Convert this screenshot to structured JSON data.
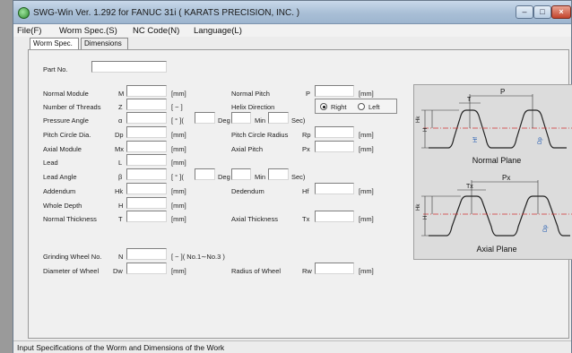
{
  "window": {
    "title": "SWG-Win Ver. 1.292 for FANUC 31i ( KARATS PRECISION, INC. )",
    "min": "–",
    "max": "□",
    "close": "×"
  },
  "menu": [
    "File(F)",
    "Worm Spec.(S)",
    "NC Code(N)",
    "Language(L)"
  ],
  "tabs": [
    "Worm Spec.",
    "Dimensions"
  ],
  "form": {
    "part_no": "Part No.",
    "normal_module": "Normal Module",
    "normal_module_sym": "M",
    "number_of_threads": "Number of Threads",
    "number_of_threads_sym": "Z",
    "pressure_angle": "Pressure Angle",
    "pressure_angle_sym": "α",
    "pitch_circle_dia": "Pitch Circle Dia.",
    "pitch_circle_dia_sym": "Dp",
    "axial_module": "Axial Module",
    "axial_module_sym": "Mx",
    "lead": "Lead",
    "lead_sym": "L",
    "lead_angle": "Lead Angle",
    "lead_angle_sym": "β",
    "addendum": "Addendum",
    "addendum_sym": "Hk",
    "whole_depth": "Whole Depth",
    "whole_depth_sym": "H",
    "normal_thickness": "Normal Thickness",
    "normal_thickness_sym": "T",
    "normal_pitch": "Normal Pitch",
    "normal_pitch_sym": "P",
    "helix_direction": "Helix Direction",
    "right": "Right",
    "left": "Left",
    "pitch_circle_radius": "Pitch Circle Radius",
    "pitch_circle_radius_sym": "Rp",
    "axial_pitch": "Axial Pitch",
    "axial_pitch_sym": "Px",
    "dedendum": "Dedendum",
    "dedendum_sym": "Hf",
    "axial_thickness": "Axial Thickness",
    "axial_thickness_sym": "Tx",
    "grinding_wheel_no": "Grinding Wheel No.",
    "grinding_wheel_no_sym": "N",
    "grinding_wheel_note": "[ − ]( No.1∼No.3 )",
    "diameter_of_wheel": "Diameter of Wheel",
    "diameter_of_wheel_sym": "Dw",
    "radius_of_wheel": "Radius of Wheel",
    "radius_of_wheel_sym": "Rw",
    "unit_mm": "[mm]",
    "unit_dash": "[ − ]",
    "unit_deg_open": "[ ° ](",
    "deg": "Deg",
    "min": "Min",
    "sec": "Sec)"
  },
  "diagram": {
    "normal_plane": "Normal Plane",
    "axial_plane": "Axial Plane",
    "p": "P",
    "t": "T",
    "px": "Px",
    "tx": "Tx",
    "hk": "Hk",
    "h": "H",
    "hf": "Hf",
    "dp": "Dp"
  },
  "status": "Input Specifications of the Worm and Dimensions of the Work"
}
